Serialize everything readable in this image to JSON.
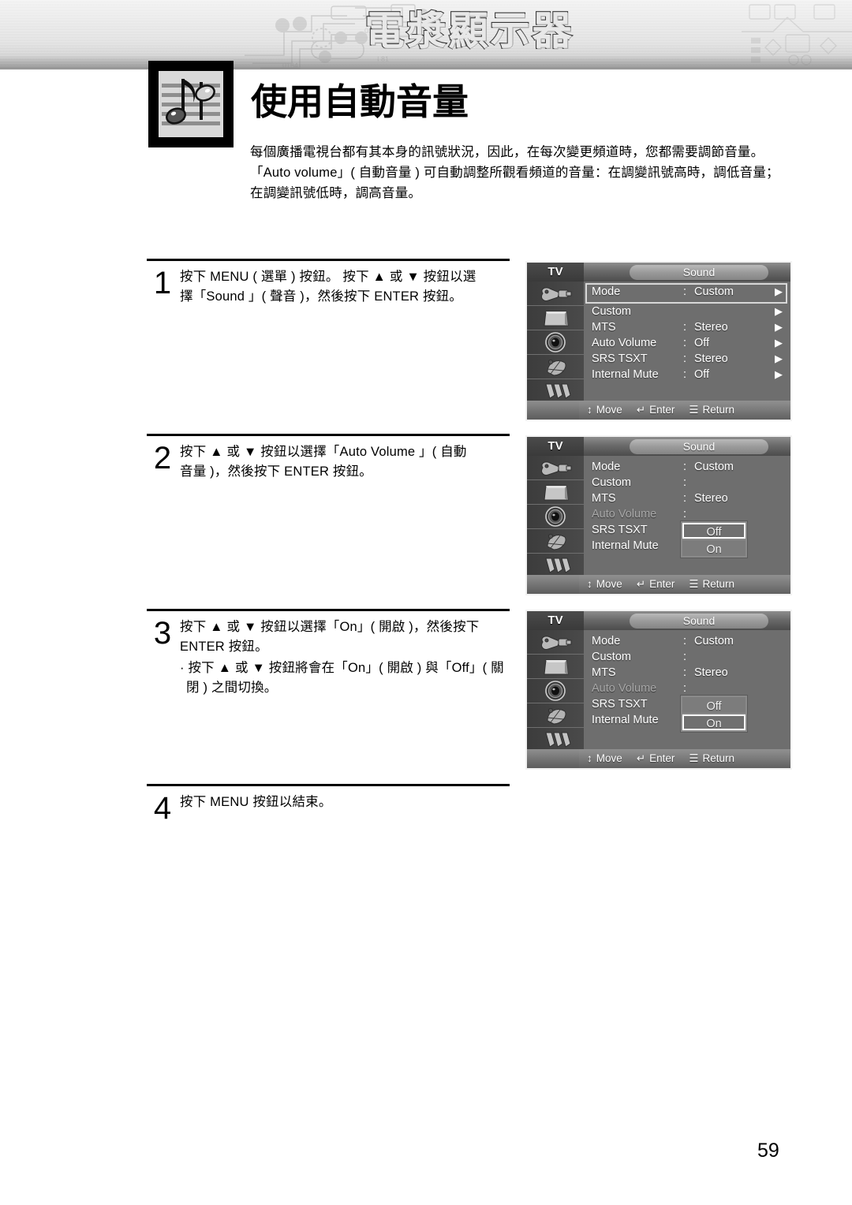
{
  "banner": {
    "title": "電漿顯示器"
  },
  "header": {
    "icon_name": "music-note-icon",
    "page_title": "使用自動音量",
    "intro_lines": [
      "每個廣播電視台都有其本身的訊號狀況，因此，在每次變更頻道時，您都需要調節音量。",
      "「Auto volume」( 自動音量 ) 可自動調整所觀看頻道的音量：在調變訊號高時，調低音量；",
      "在調變訊號低時，調高音量。"
    ]
  },
  "steps": [
    {
      "number": "1",
      "lines": [
        "按下 MENU ( 選單 ) 按鈕。 按下 ▲ 或 ▼ 按鈕以選",
        "擇「Sound 」( 聲音 )，然後按下 ENTER 按鈕。"
      ],
      "sub": ""
    },
    {
      "number": "2",
      "lines": [
        "按下 ▲ 或 ▼  按鈕以選擇「Auto Volume 」( 自動",
        "音量 )，然後按下  ENTER 按鈕。"
      ],
      "sub": ""
    },
    {
      "number": "3",
      "lines": [
        "按下 ▲ 或 ▼ 按鈕以選擇「On」( 開啟 )，然後按下",
        "ENTER 按鈕。"
      ],
      "sub": "· 按下 ▲ 或 ▼ 按鈕將會在「On」( 開啟 ) 與「Off」( 關閉 ) 之間切換。"
    },
    {
      "number": "4",
      "lines": [
        "按下 MENU 按鈕以結束。"
      ],
      "sub": ""
    }
  ],
  "osd_common": {
    "tv_label": "TV",
    "tab_label": "Sound",
    "arrow_glyph": "▶",
    "colon": ":",
    "rail_icons": [
      "input-jack-icon",
      "picture-tv-icon",
      "speaker-icon",
      "satellite-dish-icon",
      "setup-tools-icon"
    ],
    "hints": [
      {
        "icon": "updown-arrows-icon",
        "glyph": "↕",
        "label": "Move"
      },
      {
        "icon": "enter-key-icon",
        "glyph": "↵",
        "label": "Enter"
      },
      {
        "icon": "menu-key-icon",
        "glyph": "☰",
        "label": "Return"
      }
    ]
  },
  "osd_menus": [
    {
      "id": "osd-step1",
      "rows": [
        {
          "label": "Mode",
          "value": "Custom",
          "has_value": true,
          "has_arrow": true,
          "selected": true,
          "dim": false
        },
        {
          "label": "Custom",
          "value": "",
          "has_value": false,
          "has_arrow": true,
          "selected": false,
          "dim": false
        },
        {
          "label": "MTS",
          "value": "Stereo",
          "has_value": true,
          "has_arrow": true,
          "selected": false,
          "dim": false
        },
        {
          "label": "Auto Volume",
          "value": "Off",
          "has_value": true,
          "has_arrow": true,
          "selected": false,
          "dim": false
        },
        {
          "label": "SRS TSXT",
          "value": "Stereo",
          "has_value": true,
          "has_arrow": true,
          "selected": false,
          "dim": false
        },
        {
          "label": "Internal Mute",
          "value": "Off",
          "has_value": true,
          "has_arrow": true,
          "selected": false,
          "dim": false
        }
      ],
      "popup": null
    },
    {
      "id": "osd-step2",
      "rows": [
        {
          "label": "Mode",
          "value": "Custom",
          "has_value": true,
          "has_arrow": false,
          "selected": false,
          "dim": false
        },
        {
          "label": "Custom",
          "value": "",
          "has_value": false,
          "has_arrow": false,
          "selected": false,
          "dim": false
        },
        {
          "label": "MTS",
          "value": "Stereo",
          "has_value": true,
          "has_arrow": false,
          "selected": false,
          "dim": false
        },
        {
          "label": "Auto Volume",
          "value": "",
          "has_value": false,
          "has_arrow": false,
          "selected": false,
          "dim": true
        },
        {
          "label": "SRS TSXT",
          "value": "",
          "has_value": false,
          "has_arrow": false,
          "selected": false,
          "dim": false
        },
        {
          "label": "Internal Mute",
          "value": "",
          "has_value": false,
          "has_arrow": false,
          "selected": false,
          "dim": false
        }
      ],
      "popup": {
        "options": [
          "Off",
          "On"
        ],
        "active": "Off"
      }
    },
    {
      "id": "osd-step3",
      "rows": [
        {
          "label": "Mode",
          "value": "Custom",
          "has_value": true,
          "has_arrow": false,
          "selected": false,
          "dim": false
        },
        {
          "label": "Custom",
          "value": "",
          "has_value": false,
          "has_arrow": false,
          "selected": false,
          "dim": false
        },
        {
          "label": "MTS",
          "value": "Stereo",
          "has_value": true,
          "has_arrow": false,
          "selected": false,
          "dim": false
        },
        {
          "label": "Auto Volume",
          "value": "",
          "has_value": false,
          "has_arrow": false,
          "selected": false,
          "dim": true
        },
        {
          "label": "SRS TSXT",
          "value": "",
          "has_value": false,
          "has_arrow": false,
          "selected": false,
          "dim": false
        },
        {
          "label": "Internal Mute",
          "value": "",
          "has_value": false,
          "has_arrow": false,
          "selected": false,
          "dim": false
        }
      ],
      "popup": {
        "options": [
          "Off",
          "On"
        ],
        "active": "On"
      }
    }
  ],
  "footer": {
    "page_number": "59"
  },
  "colors": {
    "osd_background": "#6e6e6e",
    "osd_rail": "#4a4a4a",
    "osd_text": "#ffffff",
    "osd_dim_text": "#a8a8a8",
    "popup_background": "#7c7c7c",
    "highlight_border": "#ffffff",
    "page_background": "#ffffff",
    "rule": "#000000"
  }
}
